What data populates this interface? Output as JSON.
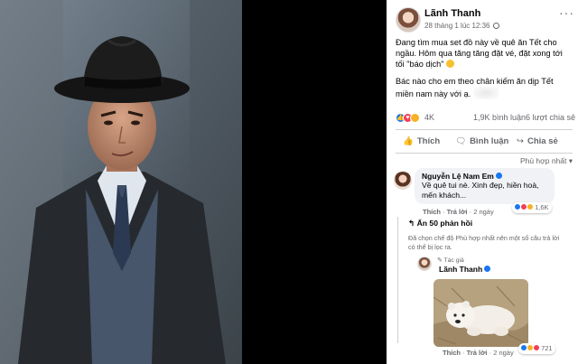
{
  "post": {
    "author": "Lãnh Thanh",
    "timestamp": "28 tháng 1 lúc 12:36",
    "text_p1": "Đang tìm mua set đồ này về quê ăn Tết cho ngầu. Hôm qua tăng tăng đặt vé, đặt xong tới tối \"báo dịch\"",
    "text_p2": "Bác nào cho em theo chân kiếm ăn dịp Tết miền nam này với ạ.",
    "menu_icon": "more-horizontal-icon",
    "privacy_icon": "globe-icon"
  },
  "stats": {
    "reactions": "4K",
    "comments": "1,9K bình luận",
    "shares": "6 lượt chia sẻ"
  },
  "actions": {
    "like": "Thích",
    "comment": "Bình luận",
    "share": "Chia sẻ"
  },
  "sort_label": "Phù hợp nhất ▾",
  "comment1": {
    "name": "Nguyễn Lệ Nam Em",
    "text": "Về quê tui nè. Xinh đẹp, hiền hoà, mến khách...",
    "like": "Thích",
    "reply": "Trả lời",
    "time": "2 ngày",
    "reaction_count": "1,6K"
  },
  "replies_toggle": "Ẩn 50 phản hồi",
  "filter_note": "Đã chọn chế độ Phù hợp nhất nên một số câu trả lời có thể bị lọc ra.",
  "reply1": {
    "author_tag": "Tác giả",
    "name": "Lãnh Thanh",
    "like": "Thích",
    "reply": "Trả lời",
    "time": "2 ngày",
    "reaction_count": "721"
  },
  "colors": {
    "facebook_blue": "#1877f2",
    "text_primary": "#050505",
    "text_secondary": "#65676b",
    "bubble_bg": "#f0f2f5"
  }
}
